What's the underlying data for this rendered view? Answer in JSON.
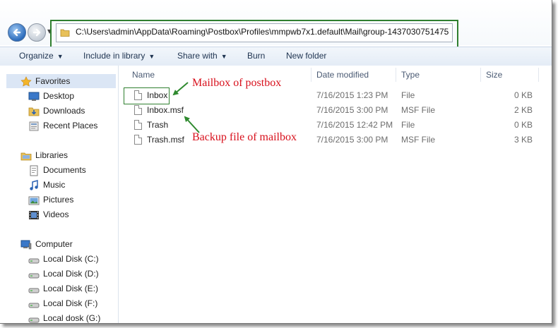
{
  "navigation": {
    "address_path": "C:\\Users\\admin\\AppData\\Roaming\\Postbox\\Profiles\\mmpwb7x1.default\\Mail\\group-1437030751475"
  },
  "toolbar": {
    "organize": "Organize",
    "include_in_library": "Include in library",
    "share_with": "Share with",
    "burn": "Burn",
    "new_folder": "New folder"
  },
  "sidebar": {
    "favorites": {
      "label": "Favorites",
      "items": [
        "Desktop",
        "Downloads",
        "Recent Places"
      ]
    },
    "libraries": {
      "label": "Libraries",
      "items": [
        "Documents",
        "Music",
        "Pictures",
        "Videos"
      ]
    },
    "computer": {
      "label": "Computer",
      "items": [
        "Local Disk (C:)",
        "Local Disk (D:)",
        "Local Disk (E:)",
        "Local Disk (F:)",
        "Local dosk  (G:)"
      ]
    }
  },
  "columns": {
    "name": "Name",
    "date": "Date modified",
    "type": "Type",
    "size": "Size"
  },
  "files": [
    {
      "name": "Inbox",
      "date": "7/16/2015 1:23 PM",
      "type": "File",
      "size": "0 KB"
    },
    {
      "name": "Inbox.msf",
      "date": "7/16/2015 3:00 PM",
      "type": "MSF File",
      "size": "2 KB"
    },
    {
      "name": "Trash",
      "date": "7/16/2015 12:42 PM",
      "type": "File",
      "size": "0 KB"
    },
    {
      "name": "Trash.msf",
      "date": "7/16/2015 3:00 PM",
      "type": "MSF File",
      "size": "3 KB"
    }
  ],
  "annotations": {
    "mailbox": "Mailbox of postbox",
    "backup": "Backup file of mailbox"
  },
  "colors": {
    "annotation_text": "#d8101c",
    "highlight_border": "#2f7f2f"
  }
}
